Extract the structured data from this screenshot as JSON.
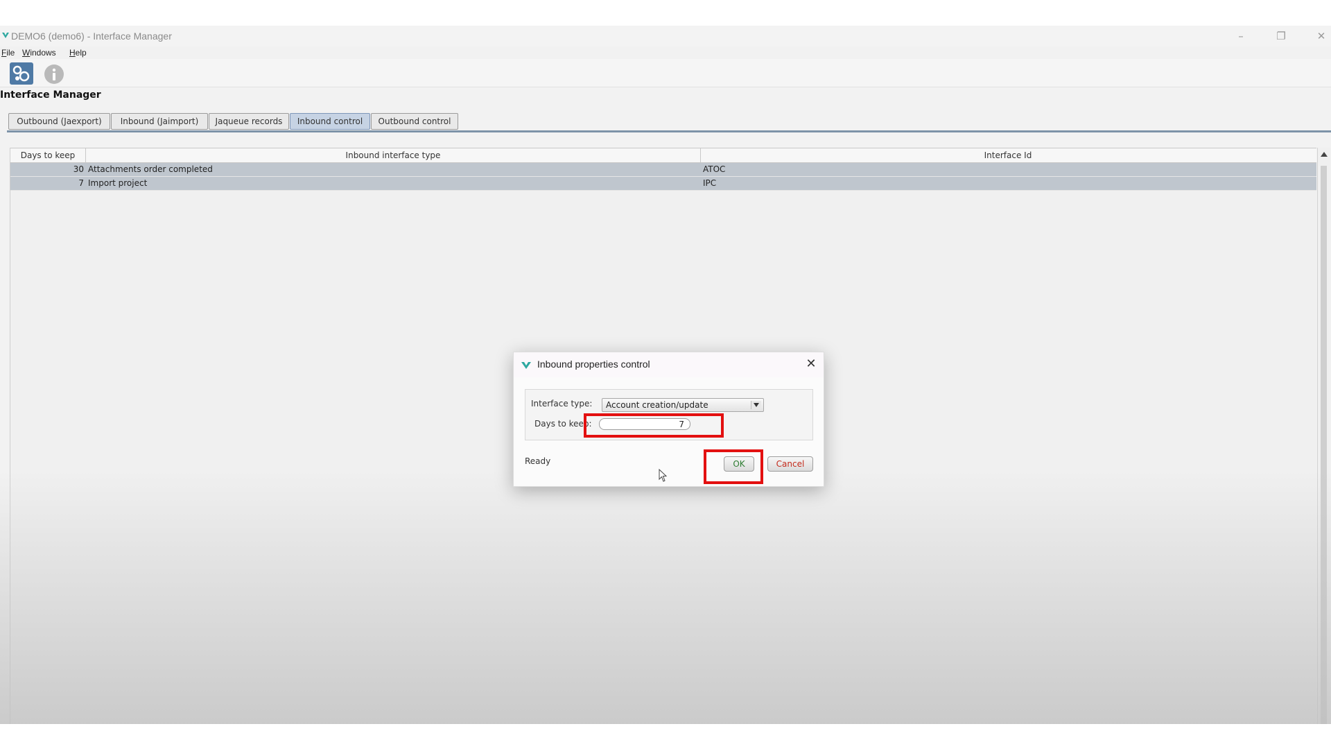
{
  "window": {
    "title": "DEMO6 (demo6) - Interface Manager",
    "controls": {
      "minimize": "–",
      "restore": "❐",
      "close": "✕"
    }
  },
  "menu": {
    "items": [
      "File",
      "Windows",
      "Help"
    ]
  },
  "toolbar": {
    "tools": [
      "interface-manager-icon",
      "info-icon"
    ]
  },
  "section": {
    "title": "Interface Manager"
  },
  "tabs": [
    {
      "label": "Outbound (Jaexport)",
      "active": false
    },
    {
      "label": "Inbound (Jaimport)",
      "active": false
    },
    {
      "label": "Jaqueue records",
      "active": false
    },
    {
      "label": "Inbound control",
      "active": true
    },
    {
      "label": "Outbound control",
      "active": false
    }
  ],
  "table": {
    "headers": [
      "Days to keep",
      "Inbound interface type",
      "Interface Id"
    ],
    "rows": [
      {
        "days": "30",
        "type": "Attachments order completed",
        "id": "ATOC"
      },
      {
        "days": "7",
        "type": "Import project",
        "id": "IPC"
      }
    ]
  },
  "dialog": {
    "title": "Inbound properties control",
    "close_glyph": "✕",
    "interface_type_label": "Interface type:",
    "interface_type_value": "Account creation/update",
    "days_label": "Days to keep:",
    "days_value": "7",
    "status": "Ready",
    "ok_label": "OK",
    "cancel_label": "Cancel"
  },
  "colors": {
    "highlight": "#e31010",
    "active_tab": "#c6d3e4",
    "selected_row": "#bfc6ce",
    "cancel_text": "#c42b1c",
    "ok_text": "#2e7d32"
  }
}
